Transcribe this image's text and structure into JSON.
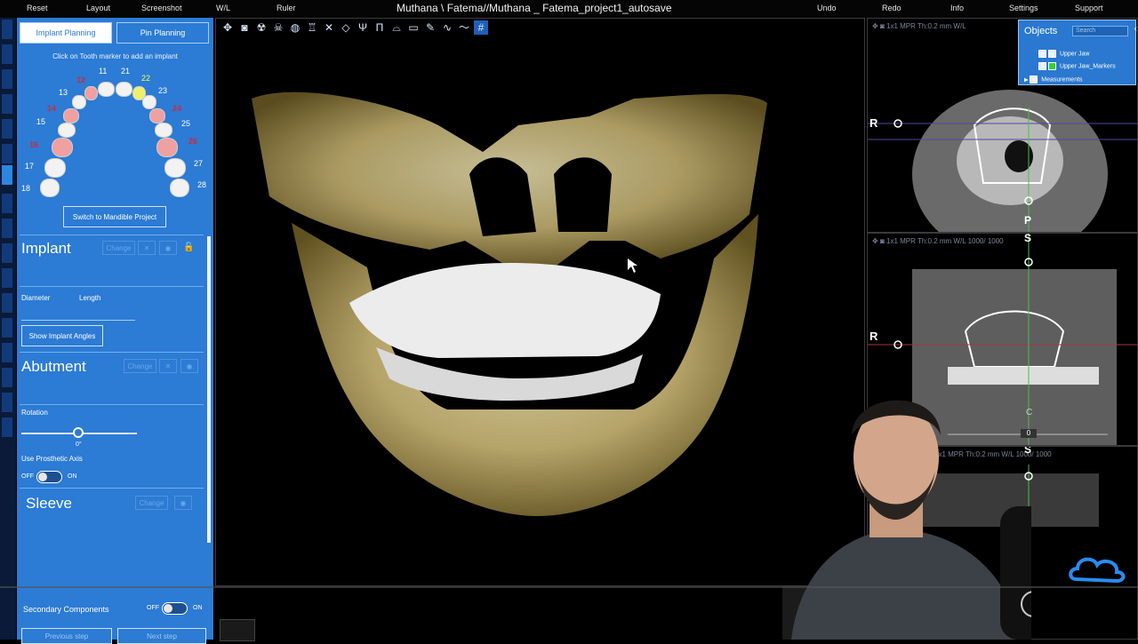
{
  "menu": {
    "reset": "Reset",
    "layout": "Layout",
    "screenshot": "Screenshot",
    "wl": "W/L",
    "ruler": "Ruler",
    "title": "Muthana \\ Fatema//Muthana _ Fatema_project1_autosave",
    "undo": "Undo",
    "redo": "Redo",
    "info": "Info",
    "settings": "Settings",
    "support": "Support"
  },
  "panel": {
    "tab_implant": "Implant Planning",
    "tab_pin": "Pin Planning",
    "hint": "Click on Tooth marker to add an implant",
    "teeth": [
      {
        "n": "11",
        "state": "normal"
      },
      {
        "n": "21",
        "state": "normal"
      },
      {
        "n": "12",
        "state": "missing"
      },
      {
        "n": "22",
        "state": "selected"
      },
      {
        "n": "13",
        "state": "normal"
      },
      {
        "n": "23",
        "state": "normal"
      },
      {
        "n": "14",
        "state": "missing"
      },
      {
        "n": "24",
        "state": "missing"
      },
      {
        "n": "15",
        "state": "normal"
      },
      {
        "n": "25",
        "state": "normal"
      },
      {
        "n": "16",
        "state": "missing"
      },
      {
        "n": "26",
        "state": "missing"
      },
      {
        "n": "17",
        "state": "normal"
      },
      {
        "n": "27",
        "state": "normal"
      },
      {
        "n": "18",
        "state": "normal"
      },
      {
        "n": "28",
        "state": "normal"
      }
    ],
    "switch_btn": "Switch to Mandible Project",
    "implant_title": "Implant",
    "change": "Change",
    "diameter": "Diameter",
    "length": "Length",
    "show_angles": "Show Implant Angles",
    "abutment_title": "Abutment",
    "rotation": "Rotation",
    "rotation_val": "0°",
    "prosthetic": "Use Prosthetic Axis",
    "off": "OFF",
    "on": "ON",
    "sleeve_title": "Sleeve",
    "secondary": "Secondary Components",
    "prev": "Previous step",
    "next": "Next step"
  },
  "views": {
    "hdr_top": "1x1   MPR   Th:0.2 mm   W/L",
    "hdr_mid": "1x1   MPR   Th:0.2 mm   W/L 1000/ 1000",
    "hdr_bot": "1x1   MPR   Th:0.2 mm   W/L 1000/ 1000",
    "r1": "R",
    "r2": "R",
    "p": "P",
    "s1": "S",
    "s2": "S",
    "c": "C",
    "zero": "0"
  },
  "objects": {
    "title": "Objects",
    "search": "Search",
    "items": [
      "Upper Jaw",
      "Upper Jaw_Markers",
      "Measurements"
    ]
  },
  "colors": {
    "panel_blue": "#2c7bd4",
    "missing_tooth": "#f0a0a0",
    "selected_tooth": "#eef06a"
  }
}
